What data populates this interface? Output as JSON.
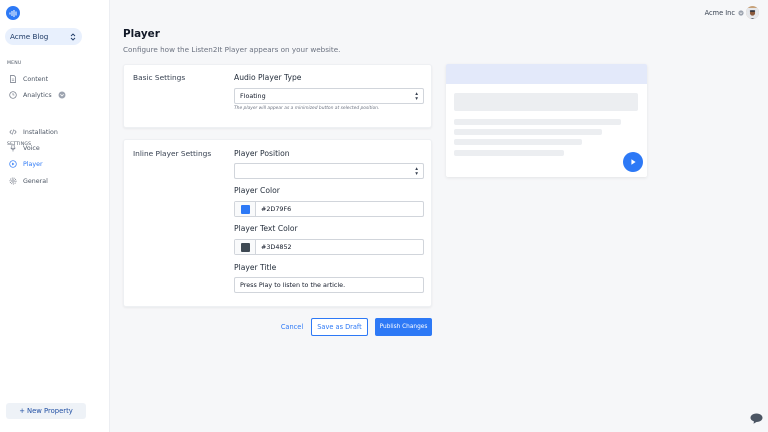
{
  "sidebar": {
    "property": "Acme Blog",
    "menu_title": "MENU",
    "menu_items": [
      {
        "label": "Content",
        "icon": "document-icon"
      },
      {
        "label": "Analytics",
        "icon": "clock-icon"
      }
    ],
    "settings_title": "SETTINGS",
    "settings_items": [
      {
        "label": "Installation",
        "icon": "code-icon"
      },
      {
        "label": "Voice",
        "icon": "microphone-icon"
      },
      {
        "label": "Player",
        "icon": "play-circle-icon",
        "active": true
      },
      {
        "label": "General",
        "icon": "gear-icon"
      }
    ],
    "new_property": "+ New Property"
  },
  "topbar": {
    "org": "Acme Inc"
  },
  "page": {
    "title": "Player",
    "subtitle": "Configure how the Listen2It Player appears on your website."
  },
  "basic_settings": {
    "title": "Basic Settings",
    "player_type_label": "Audio Player Type",
    "player_type_value": "Floating",
    "player_type_hint": "The player will appear as a minimized button at selected position."
  },
  "inline_settings": {
    "title": "Inline Player Settings",
    "position_label": "Player Position",
    "position_value": "",
    "color_label": "Player Color",
    "color_value": "#2D79F6",
    "text_color_label": "Player Text Color",
    "text_color_value": "#3D4852",
    "title_label": "Player Title",
    "title_value": "Press Play to listen to the article."
  },
  "actions": {
    "cancel": "Cancel",
    "draft": "Save as Draft",
    "publish": "Publish Changes"
  },
  "colors": {
    "accent": "#2d79f6",
    "player_color": "#2d79f6",
    "player_text_color": "#3d4852",
    "preview_bar": "#e3e9fa"
  }
}
